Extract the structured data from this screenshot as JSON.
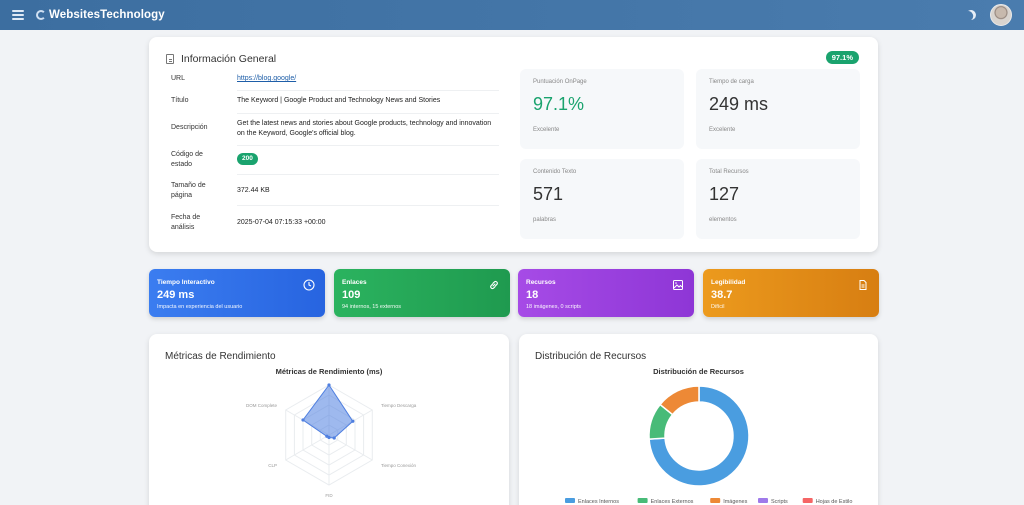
{
  "app": {
    "brand": "WebsitesTechnology"
  },
  "info": {
    "title": "Información General",
    "score_badge": "97.1%",
    "rows": [
      {
        "label": "URL",
        "value": "https://blog.google/"
      },
      {
        "label": "Título",
        "value": "The Keyword | Google Product and Technology News and Stories"
      },
      {
        "label": "Descripción",
        "value": "Get the latest news and stories about Google products, technology and innovation on the Keyword, Google's official blog."
      },
      {
        "label": "Código de estado",
        "value": "200"
      },
      {
        "label": "Tamaño de página",
        "value": "372.44 KB"
      },
      {
        "label": "Fecha de análisis",
        "value": "2025-07-04 07:15:33 +00:00"
      }
    ],
    "stats": [
      {
        "title": "Puntuación OnPage",
        "value": "97.1%",
        "sub": "Excelente"
      },
      {
        "title": "Tiempo de carga",
        "value": "249 ms",
        "sub": "Excelente"
      },
      {
        "title": "Contenido Texto",
        "value": "571",
        "sub": "palabras"
      },
      {
        "title": "Total Recursos",
        "value": "127",
        "sub": "elementos"
      }
    ]
  },
  "tiles": [
    {
      "title": "Tiempo Interactivo",
      "value": "249 ms",
      "sub": "Impacta en experiencia del usuario",
      "icon": "clock-icon"
    },
    {
      "title": "Enlaces",
      "value": "109",
      "sub": "94 internos, 15 externos",
      "icon": "link-icon"
    },
    {
      "title": "Recursos",
      "value": "18",
      "sub": "18 imágenes, 0 scripts",
      "icon": "image-icon"
    },
    {
      "title": "Legibilidad",
      "value": "38.7",
      "sub": "Difícil",
      "icon": "document-icon"
    }
  ],
  "perf_card": {
    "title": "Métricas de Rendimiento"
  },
  "dist_card": {
    "title": "Distribución de Recursos"
  },
  "chart_data": [
    {
      "type": "radar",
      "title": "Métricas de Rendimiento (ms)",
      "categories": [
        "Tiempo Interactivo",
        "Tiempo Descarga",
        "Tiempo Conexión",
        "FID",
        "CLP",
        "DOM Complete"
      ],
      "visible_labels": [
        "Tiempo Descarga",
        "Tiempo Conexión",
        "FID",
        "CLP",
        "DOM Complete"
      ],
      "values": [
        1.0,
        0.55,
        0.12,
        0.05,
        0.05,
        0.6
      ],
      "color": "#4f7fe0"
    },
    {
      "type": "doughnut",
      "title": "Distribución de Recursos",
      "labels": [
        "Enlaces Internos",
        "Enlaces Externos",
        "Imágenes",
        "Scripts",
        "Hojas de Estilo"
      ],
      "values": [
        94,
        15,
        18,
        0,
        0
      ],
      "colors": [
        "#4a9de0",
        "#48bb78",
        "#ed8936",
        "#9f7aea",
        "#f56565"
      ]
    }
  ]
}
